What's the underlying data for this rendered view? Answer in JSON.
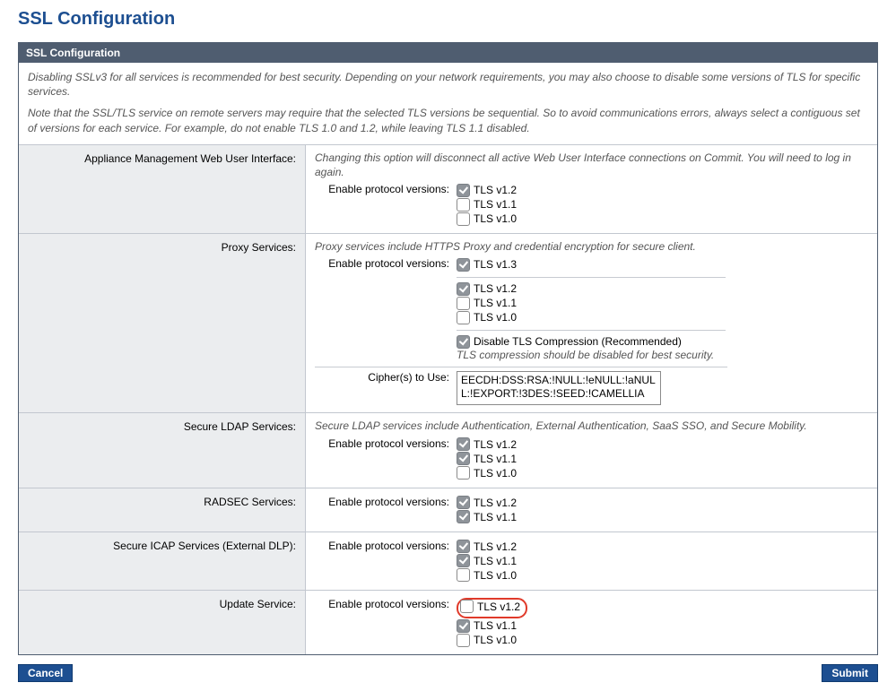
{
  "page_title": "SSL Configuration",
  "panel_title": "SSL Configuration",
  "notes": {
    "p1": "Disabling SSLv3 for all services is recommended for best security. Depending on your network requirements, you may also choose to disable some versions of TLS for specific services.",
    "p2": "Note that the SSL/TLS service on remote servers may require that the selected TLS versions be sequential. So to avoid communications errors, always select a contiguous set of versions for each service. For example, do not enable TLS 1.0 and 1.2, while leaving TLS 1.1 disabled."
  },
  "labels": {
    "enable_protocol_versions": "Enable protocol versions:",
    "ciphers_to_use": "Cipher(s) to Use:"
  },
  "services": {
    "appliance": {
      "label": "Appliance Management Web User Interface:",
      "desc": "Changing this option will disconnect all active Web User Interface connections on Commit. You will need to log in again.",
      "prot": {
        "tls12": {
          "label": "TLS v1.2",
          "checked": true
        },
        "tls11": {
          "label": "TLS v1.1",
          "checked": false
        },
        "tls10": {
          "label": "TLS v1.0",
          "checked": false
        }
      }
    },
    "proxy": {
      "label": "Proxy Services:",
      "desc": "Proxy services include HTTPS Proxy and credential encryption for secure client.",
      "prot": {
        "tls13": {
          "label": "TLS v1.3",
          "checked": true
        },
        "tls12": {
          "label": "TLS v1.2",
          "checked": true
        },
        "tls11": {
          "label": "TLS v1.1",
          "checked": false
        },
        "tls10": {
          "label": "TLS v1.0",
          "checked": false
        }
      },
      "disable_comp": {
        "label": "Disable TLS Compression (Recommended)",
        "checked": true
      },
      "comp_note": "TLS compression should be disabled for best security.",
      "cipher_value": "EECDH:DSS:RSA:!NULL:!eNULL:!aNULL:!EXPORT:!3DES:!SEED:!CAMELLIA"
    },
    "ldap": {
      "label": "Secure LDAP Services:",
      "desc": "Secure LDAP services include Authentication, External Authentication, SaaS SSO, and Secure Mobility.",
      "prot": {
        "tls12": {
          "label": "TLS v1.2",
          "checked": true
        },
        "tls11": {
          "label": "TLS v1.1",
          "checked": true
        },
        "tls10": {
          "label": "TLS v1.0",
          "checked": false
        }
      }
    },
    "radsec": {
      "label": "RADSEC Services:",
      "prot": {
        "tls12": {
          "label": "TLS v1.2",
          "checked": true
        },
        "tls11": {
          "label": "TLS v1.1",
          "checked": true
        }
      }
    },
    "icap": {
      "label": "Secure ICAP Services (External DLP):",
      "prot": {
        "tls12": {
          "label": "TLS v1.2",
          "checked": true
        },
        "tls11": {
          "label": "TLS v1.1",
          "checked": true
        },
        "tls10": {
          "label": "TLS v1.0",
          "checked": false
        }
      }
    },
    "update": {
      "label": "Update Service:",
      "prot": {
        "tls12": {
          "label": "TLS v1.2",
          "checked": false
        },
        "tls11": {
          "label": "TLS v1.1",
          "checked": true
        },
        "tls10": {
          "label": "TLS v1.0",
          "checked": false
        }
      }
    }
  },
  "buttons": {
    "cancel": "Cancel",
    "submit": "Submit"
  }
}
